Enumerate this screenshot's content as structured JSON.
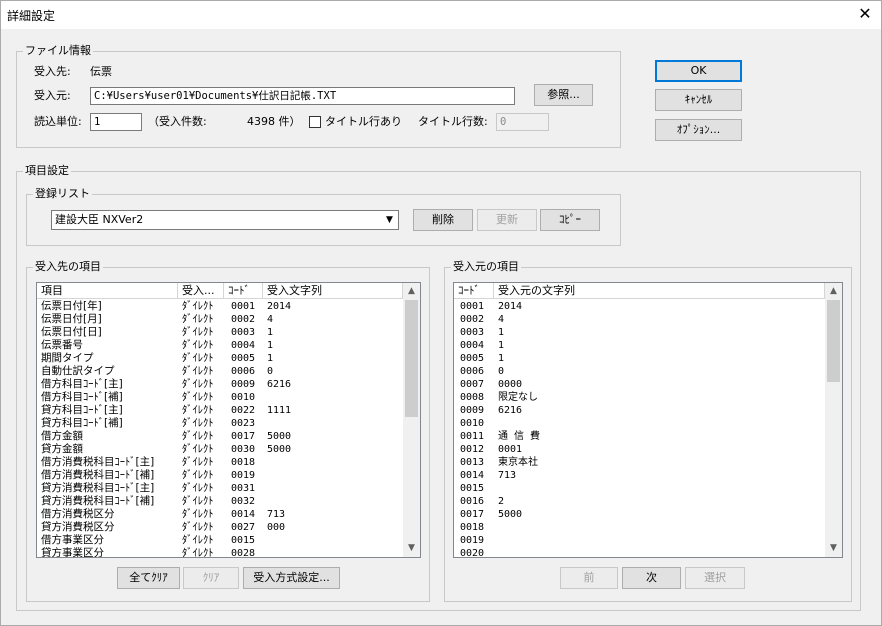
{
  "window": {
    "title": "詳細設定",
    "close": "✕"
  },
  "file_info": {
    "legend": "ファイル情報",
    "dest_label": "受入先:",
    "dest_value": "伝票",
    "source_label": "受入元:",
    "source_path": "C:¥Users¥user01¥Documents¥仕訳日記帳.TXT",
    "browse_button": "参照...",
    "read_unit_label": "読込単位:",
    "read_unit_value": "1",
    "count_label": "（受入件数:",
    "count_value": "4398 件）",
    "title_row_checkbox_label": "タイトル行あり",
    "title_row_count_label": "タイトル行数:",
    "title_row_count_value": "0"
  },
  "dialog_buttons": {
    "ok": "OK",
    "cancel": "ｷｬﾝｾﾙ",
    "options": "ｵﾌﾟｼｮﾝ..."
  },
  "item_settings": {
    "legend": "項目設定",
    "register_list": {
      "legend": "登録リスト",
      "selected": "建設大臣 NXVer2",
      "delete": "削除",
      "update": "更新",
      "copy": "ｺﾋﾟｰ"
    }
  },
  "dest_items": {
    "legend": "受入先の項目",
    "headers": [
      "項目",
      "受入...",
      "ｺｰﾄﾞ",
      "受入文字列"
    ],
    "rows": [
      [
        "伝票日付[年]",
        "ﾀﾞｲﾚｸﾄ",
        "0001",
        "2014"
      ],
      [
        "伝票日付[月]",
        "ﾀﾞｲﾚｸﾄ",
        "0002",
        "4"
      ],
      [
        "伝票日付[日]",
        "ﾀﾞｲﾚｸﾄ",
        "0003",
        "1"
      ],
      [
        "伝票番号",
        "ﾀﾞｲﾚｸﾄ",
        "0004",
        "1"
      ],
      [
        "期間タイプ",
        "ﾀﾞｲﾚｸﾄ",
        "0005",
        "1"
      ],
      [
        "自動仕訳タイプ",
        "ﾀﾞｲﾚｸﾄ",
        "0006",
        "0"
      ],
      [
        "借方科目ｺｰﾄﾞ[主]",
        "ﾀﾞｲﾚｸﾄ",
        "0009",
        "6216"
      ],
      [
        "借方科目ｺｰﾄﾞ[補]",
        "ﾀﾞｲﾚｸﾄ",
        "0010",
        ""
      ],
      [
        "貸方科目ｺｰﾄﾞ[主]",
        "ﾀﾞｲﾚｸﾄ",
        "0022",
        "1111"
      ],
      [
        "貸方科目ｺｰﾄﾞ[補]",
        "ﾀﾞｲﾚｸﾄ",
        "0023",
        ""
      ],
      [
        "借方金額",
        "ﾀﾞｲﾚｸﾄ",
        "0017",
        "5000"
      ],
      [
        "貸方金額",
        "ﾀﾞｲﾚｸﾄ",
        "0030",
        "5000"
      ],
      [
        "借方消費税科目ｺｰﾄﾞ[主]",
        "ﾀﾞｲﾚｸﾄ",
        "0018",
        ""
      ],
      [
        "借方消費税科目ｺｰﾄﾞ[補]",
        "ﾀﾞｲﾚｸﾄ",
        "0019",
        ""
      ],
      [
        "貸方消費税科目ｺｰﾄﾞ[主]",
        "ﾀﾞｲﾚｸﾄ",
        "0031",
        ""
      ],
      [
        "貸方消費税科目ｺｰﾄﾞ[補]",
        "ﾀﾞｲﾚｸﾄ",
        "0032",
        ""
      ],
      [
        "借方消費税区分",
        "ﾀﾞｲﾚｸﾄ",
        "0014",
        "713"
      ],
      [
        "貸方消費税区分",
        "ﾀﾞｲﾚｸﾄ",
        "0027",
        "000"
      ],
      [
        "借方事業区分",
        "ﾀﾞｲﾚｸﾄ",
        "0015",
        ""
      ],
      [
        "貸方事業区分",
        "ﾀﾞｲﾚｸﾄ",
        "0028",
        ""
      ]
    ],
    "clear_all": "全てｸﾘｱ",
    "clear": "ｸﾘｱ",
    "method_settings": "受入方式設定..."
  },
  "source_items": {
    "legend": "受入元の項目",
    "headers": [
      "ｺｰﾄﾞ",
      "受入元の文字列"
    ],
    "rows": [
      [
        "0001",
        "2014"
      ],
      [
        "0002",
        "4"
      ],
      [
        "0003",
        "1"
      ],
      [
        "0004",
        "1"
      ],
      [
        "0005",
        "1"
      ],
      [
        "0006",
        "0"
      ],
      [
        "0007",
        "0000"
      ],
      [
        "0008",
        "限定なし"
      ],
      [
        "0009",
        "6216"
      ],
      [
        "0010",
        ""
      ],
      [
        "0011",
        "通 信 費"
      ],
      [
        "0012",
        "0001"
      ],
      [
        "0013",
        "東京本社"
      ],
      [
        "0014",
        "713"
      ],
      [
        "0015",
        ""
      ],
      [
        "0016",
        "2"
      ],
      [
        "0017",
        "5000"
      ],
      [
        "0018",
        ""
      ],
      [
        "0019",
        ""
      ],
      [
        "0020",
        ""
      ]
    ],
    "prev": "前",
    "next": "次",
    "select": "選択"
  }
}
